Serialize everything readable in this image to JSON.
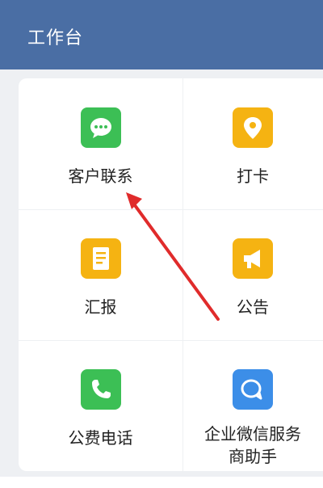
{
  "header": {
    "title": "工作台"
  },
  "apps": [
    {
      "label": "客户联系",
      "icon": "wechat-chat-icon",
      "color": "#3cbf55"
    },
    {
      "label": "打卡",
      "icon": "location-pin-icon",
      "color": "#f5b312"
    },
    {
      "label": "汇报",
      "icon": "report-document-icon",
      "color": "#f5b312"
    },
    {
      "label": "公告",
      "icon": "megaphone-icon",
      "color": "#f5b312"
    },
    {
      "label": "公费电话",
      "icon": "phone-icon",
      "color": "#3cbf55"
    },
    {
      "label_line1": "企业微信服务",
      "label_line2": "商助手",
      "icon": "chat-bubbles-icon",
      "color": "#3c8ee8"
    }
  ],
  "annotation": {
    "type": "arrow",
    "color": "#e02b2b"
  }
}
